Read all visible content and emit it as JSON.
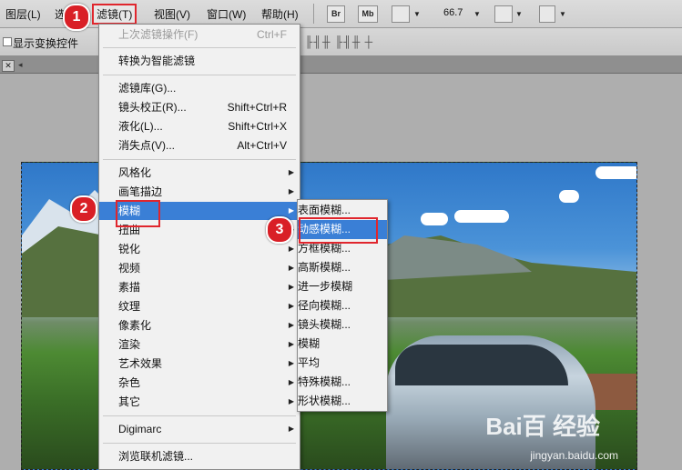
{
  "menubar": {
    "items": [
      "图层(L)",
      "选",
      "滤镜(T)",
      "视图(V)",
      "窗口(W)",
      "帮助(H)"
    ],
    "br_label": "Br",
    "mb_label": "Mb",
    "zoom": "66.7"
  },
  "options": {
    "show_transform_label": "显示变换控件"
  },
  "filter_menu": {
    "items": [
      {
        "label": "上次滤镜操作(F)",
        "shortcut": "Ctrl+F"
      },
      {
        "label": "转换为智能滤镜"
      },
      {
        "label": "滤镜库(G)..."
      },
      {
        "label": "镜头校正(R)...",
        "shortcut": "Shift+Ctrl+R"
      },
      {
        "label": "液化(L)...",
        "shortcut": "Shift+Ctrl+X"
      },
      {
        "label": "消失点(V)...",
        "shortcut": "Alt+Ctrl+V"
      },
      {
        "label": "风格化"
      },
      {
        "label": "画笔描边"
      },
      {
        "label": "模糊"
      },
      {
        "label": "扭曲"
      },
      {
        "label": "锐化"
      },
      {
        "label": "视频"
      },
      {
        "label": "素描"
      },
      {
        "label": "纹理"
      },
      {
        "label": "像素化"
      },
      {
        "label": "渲染"
      },
      {
        "label": "艺术效果"
      },
      {
        "label": "杂色"
      },
      {
        "label": "其它"
      },
      {
        "label": "Digimarc"
      },
      {
        "label": "浏览联机滤镜..."
      }
    ]
  },
  "blur_submenu": {
    "items": [
      "表面模糊...",
      "动感模糊...",
      "方框模糊...",
      "高斯模糊...",
      "进一步模糊",
      "径向模糊...",
      "镜头模糊...",
      "模糊",
      "平均",
      "特殊模糊...",
      "形状模糊..."
    ]
  },
  "badges": [
    "1",
    "2",
    "3"
  ],
  "watermark": {
    "logo": "Bai百 经验",
    "url": "jingyan.baidu.com"
  },
  "colors": {
    "highlight": "#3a7fd6",
    "annotation_red": "#e0262d"
  }
}
